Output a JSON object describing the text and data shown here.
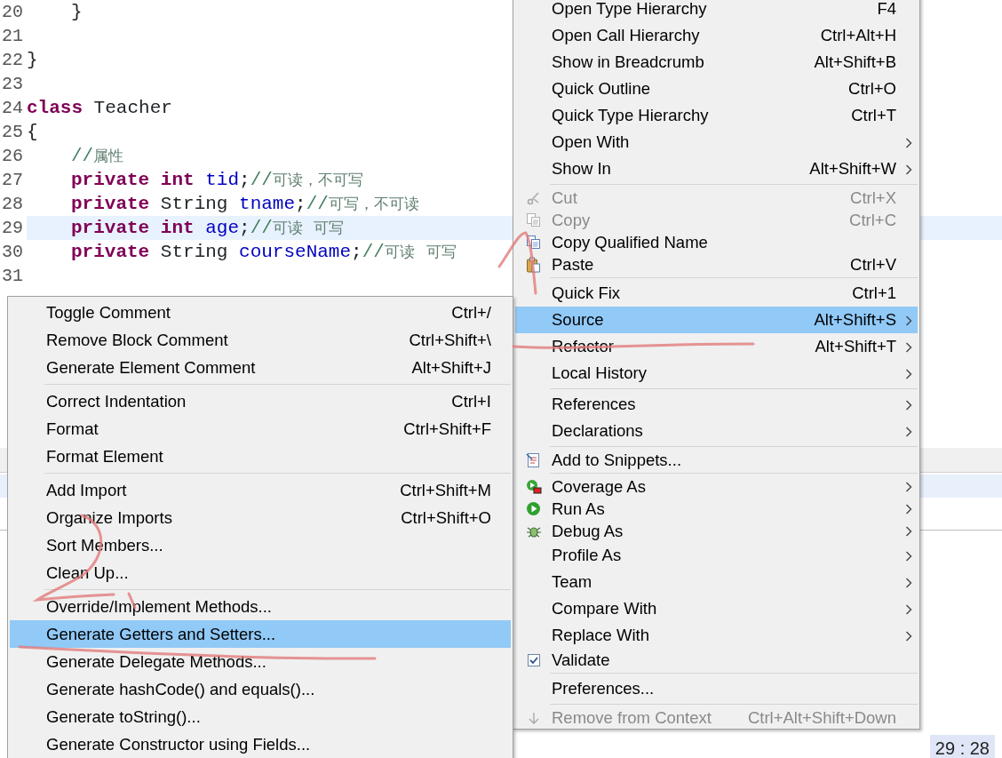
{
  "editor": {
    "lines": [
      {
        "number": "20",
        "current": false,
        "indented": true,
        "tokens": [
          {
            "kind": "plain",
            "text": "}"
          }
        ]
      },
      {
        "number": "21",
        "current": false
      },
      {
        "number": "22",
        "current": false,
        "indented": false,
        "tokens": [
          {
            "kind": "plain",
            "text": "}"
          }
        ]
      },
      {
        "number": "23",
        "current": false
      },
      {
        "number": "24",
        "current": false,
        "indented": false,
        "tokens": [
          {
            "kind": "keyword",
            "text": "class"
          },
          {
            "kind": "plain",
            "text": " Teacher"
          }
        ]
      },
      {
        "number": "25",
        "current": false,
        "indented": false,
        "tokens": [
          {
            "kind": "plain",
            "text": "{"
          }
        ]
      },
      {
        "number": "26",
        "current": false,
        "indented": true,
        "tokens": [
          {
            "kind": "comment",
            "text": "//属性"
          }
        ]
      },
      {
        "number": "27",
        "current": false,
        "indented": true,
        "tokens": [
          {
            "kind": "keyword",
            "text": "private int"
          },
          {
            "kind": "field",
            "text": " tid"
          },
          {
            "kind": "plain",
            "text": ";"
          },
          {
            "kind": "comment",
            "text": "//可读，不可写"
          }
        ]
      },
      {
        "number": "28",
        "current": false,
        "indented": true,
        "tokens": [
          {
            "kind": "keyword",
            "text": "private"
          },
          {
            "kind": "plain",
            "text": " String "
          },
          {
            "kind": "field",
            "text": "tname"
          },
          {
            "kind": "plain",
            "text": ";"
          },
          {
            "kind": "comment",
            "text": "//可写，不可读"
          }
        ]
      },
      {
        "number": "29",
        "current": true,
        "indented": true,
        "tokens": [
          {
            "kind": "keyword",
            "text": "private int"
          },
          {
            "kind": "field",
            "text": " age"
          },
          {
            "kind": "plain",
            "text": ";"
          },
          {
            "kind": "comment",
            "text": "//可读 可写"
          }
        ]
      },
      {
        "number": "30",
        "current": false,
        "indented": true,
        "tokens": [
          {
            "kind": "keyword",
            "text": "private"
          },
          {
            "kind": "plain",
            "text": " String "
          },
          {
            "kind": "field",
            "text": "courseName"
          },
          {
            "kind": "plain",
            "text": ";"
          },
          {
            "kind": "comment",
            "text": "//可读 可写"
          }
        ]
      },
      {
        "number": "31",
        "current": false
      }
    ]
  },
  "context_menu": {
    "items": [
      {
        "kind": "item",
        "label": "Open Type Hierarchy",
        "shortcut": "F4",
        "submenu": false,
        "disabled": false,
        "selected": false
      },
      {
        "kind": "item",
        "label": "Open Call Hierarchy",
        "shortcut": "Ctrl+Alt+H",
        "submenu": false,
        "disabled": false,
        "selected": false
      },
      {
        "kind": "item",
        "label": "Show in Breadcrumb",
        "shortcut": "Alt+Shift+B",
        "submenu": false,
        "disabled": false,
        "selected": false
      },
      {
        "kind": "item",
        "label": "Quick Outline",
        "shortcut": "Ctrl+O",
        "submenu": false,
        "disabled": false,
        "selected": false
      },
      {
        "kind": "item",
        "label": "Quick Type Hierarchy",
        "shortcut": "Ctrl+T",
        "submenu": false,
        "disabled": false,
        "selected": false
      },
      {
        "kind": "item",
        "label": "Open With",
        "submenu": true,
        "disabled": false,
        "selected": false
      },
      {
        "kind": "item",
        "label": "Show In",
        "shortcut": "Alt+Shift+W",
        "submenu": true,
        "disabled": false,
        "selected": false
      },
      {
        "kind": "separator"
      },
      {
        "kind": "item",
        "label": "Cut",
        "shortcut": "Ctrl+X",
        "submenu": false,
        "disabled": true,
        "selected": false
      },
      {
        "kind": "item",
        "label": "Copy",
        "shortcut": "Ctrl+C",
        "submenu": false,
        "disabled": true,
        "selected": false
      },
      {
        "kind": "item",
        "label": "Copy Qualified Name",
        "submenu": false,
        "disabled": false,
        "selected": false
      },
      {
        "kind": "item",
        "label": "Paste",
        "shortcut": "Ctrl+V",
        "submenu": false,
        "disabled": false,
        "selected": false
      },
      {
        "kind": "separator"
      },
      {
        "kind": "item",
        "label": "Quick Fix",
        "shortcut": "Ctrl+1",
        "submenu": false,
        "disabled": false,
        "selected": false
      },
      {
        "kind": "item",
        "label": "Source",
        "shortcut": "Alt+Shift+S",
        "submenu": true,
        "disabled": false,
        "selected": true
      },
      {
        "kind": "item",
        "label": "Refactor",
        "shortcut": "Alt+Shift+T",
        "submenu": true,
        "disabled": false,
        "selected": false
      },
      {
        "kind": "item",
        "label": "Local History",
        "submenu": true,
        "disabled": false,
        "selected": false
      },
      {
        "kind": "separator"
      },
      {
        "kind": "item",
        "label": "References",
        "submenu": true,
        "disabled": false,
        "selected": false
      },
      {
        "kind": "item",
        "label": "Declarations",
        "submenu": true,
        "disabled": false,
        "selected": false
      },
      {
        "kind": "separator"
      },
      {
        "kind": "item",
        "label": "Add to Snippets...",
        "submenu": false,
        "disabled": false,
        "selected": false
      },
      {
        "kind": "separator"
      },
      {
        "kind": "item",
        "label": "Coverage As",
        "submenu": true,
        "disabled": false,
        "selected": false
      },
      {
        "kind": "item",
        "label": "Run As",
        "submenu": true,
        "disabled": false,
        "selected": false
      },
      {
        "kind": "item",
        "label": "Debug As",
        "submenu": true,
        "disabled": false,
        "selected": false
      },
      {
        "kind": "item",
        "label": "Profile As",
        "submenu": true,
        "disabled": false,
        "selected": false
      },
      {
        "kind": "item",
        "label": "Team",
        "submenu": true,
        "disabled": false,
        "selected": false
      },
      {
        "kind": "item",
        "label": "Compare With",
        "submenu": true,
        "disabled": false,
        "selected": false
      },
      {
        "kind": "item",
        "label": "Replace With",
        "submenu": true,
        "disabled": false,
        "selected": false
      },
      {
        "kind": "item",
        "label": "Validate",
        "submenu": false,
        "disabled": false,
        "selected": false
      },
      {
        "kind": "separator"
      },
      {
        "kind": "item",
        "label": "Preferences...",
        "submenu": false,
        "disabled": false,
        "selected": false
      },
      {
        "kind": "separator"
      },
      {
        "kind": "item",
        "label": "Remove from Context",
        "shortcut": "Ctrl+Alt+Shift+Down",
        "submenu": false,
        "disabled": true,
        "selected": false
      }
    ]
  },
  "source_submenu": {
    "items": [
      {
        "kind": "item",
        "label": "Toggle Comment",
        "shortcut": "Ctrl+/",
        "selected": false
      },
      {
        "kind": "item",
        "label": "Remove Block Comment",
        "shortcut": "Ctrl+Shift+\\",
        "selected": false
      },
      {
        "kind": "item",
        "label": "Generate Element Comment",
        "shortcut": "Alt+Shift+J",
        "selected": false
      },
      {
        "kind": "separator"
      },
      {
        "kind": "item",
        "label": "Correct Indentation",
        "shortcut": "Ctrl+I",
        "selected": false
      },
      {
        "kind": "item",
        "label": "Format",
        "shortcut": "Ctrl+Shift+F",
        "selected": false
      },
      {
        "kind": "item",
        "label": "Format Element",
        "selected": false
      },
      {
        "kind": "separator"
      },
      {
        "kind": "item",
        "label": "Add Import",
        "shortcut": "Ctrl+Shift+M",
        "selected": false
      },
      {
        "kind": "item",
        "label": "Organize Imports",
        "shortcut": "Ctrl+Shift+O",
        "selected": false
      },
      {
        "kind": "item",
        "label": "Sort Members...",
        "selected": false
      },
      {
        "kind": "item",
        "label": "Clean Up...",
        "selected": false
      },
      {
        "kind": "separator"
      },
      {
        "kind": "item",
        "label": "Override/Implement Methods...",
        "selected": false
      },
      {
        "kind": "item",
        "label": "Generate Getters and Setters...",
        "selected": true
      },
      {
        "kind": "item",
        "label": "Generate Delegate Methods...",
        "selected": false
      },
      {
        "kind": "item",
        "label": "Generate hashCode() and equals()...",
        "selected": false
      },
      {
        "kind": "item",
        "label": "Generate toString()...",
        "selected": false
      },
      {
        "kind": "item",
        "label": "Generate Constructor using Fields...",
        "selected": false
      }
    ]
  },
  "status_bar": {
    "position": "29 : 28"
  }
}
